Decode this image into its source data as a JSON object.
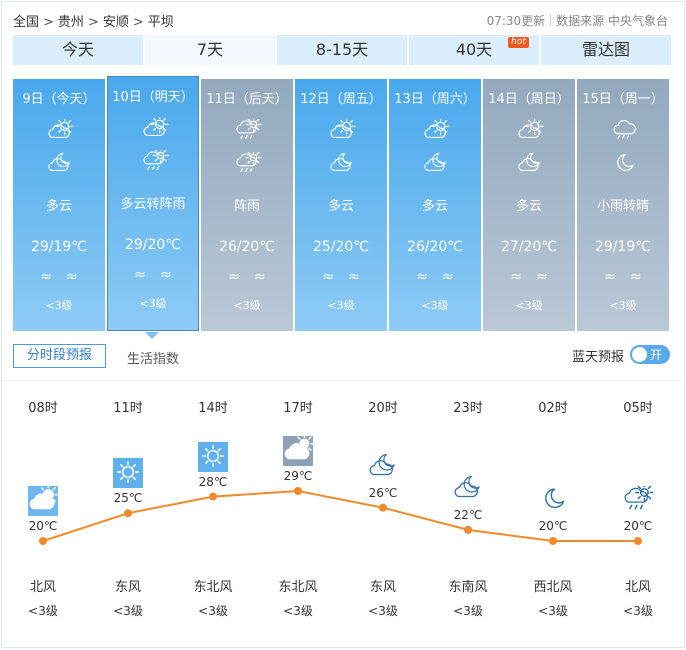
{
  "breadcrumb": [
    "全国",
    "贵州",
    "安顺",
    "平坝"
  ],
  "breadcrumb_sep": ">",
  "meta": {
    "updated": "07:30更新",
    "source": "数据来源 中央气象台"
  },
  "tabs": [
    {
      "label": "今天",
      "active": false
    },
    {
      "label": "7天",
      "active": true
    },
    {
      "label": "8-15天",
      "active": false
    },
    {
      "label": "40天",
      "active": false,
      "badge": "hot"
    },
    {
      "label": "雷达图",
      "active": false
    }
  ],
  "days": [
    {
      "label": "9日（今天）",
      "icon_day": "partly-cloudy-day-icon",
      "icon_night": "cloudy-night-icon",
      "weather": "多云",
      "temp": "29/19℃",
      "wind": "≈≈",
      "level": "<3级",
      "style": "sunny"
    },
    {
      "label": "10日（明天）",
      "icon_day": "partly-cloudy-day-icon",
      "icon_night": "shower-rain-icon",
      "weather": "多云转阵雨",
      "temp": "29/20℃",
      "wind": "≈≈",
      "level": "<3级",
      "style": "sunny",
      "selected": true
    },
    {
      "label": "11日（后天）",
      "icon_day": "shower-day-icon",
      "icon_night": "shower-rain-icon",
      "weather": "阵雨",
      "temp": "26/20℃",
      "wind": "≈≈",
      "level": "<3级",
      "style": "grey"
    },
    {
      "label": "12日（周五）",
      "icon_day": "partly-cloudy-day-icon",
      "icon_night": "cloudy-night-icon",
      "weather": "多云",
      "temp": "25/20℃",
      "wind": "≈≈",
      "level": "<3级",
      "style": "sunny"
    },
    {
      "label": "13日（周六）",
      "icon_day": "partly-cloudy-day-icon",
      "icon_night": "cloudy-night-icon",
      "weather": "多云",
      "temp": "26/20℃",
      "wind": "≈≈",
      "level": "<3级",
      "style": "sunny"
    },
    {
      "label": "14日（周日）",
      "icon_day": "partly-cloudy-day-icon",
      "icon_night": "cloudy-night-icon",
      "weather": "多云",
      "temp": "27/20℃",
      "wind": "≈≈",
      "level": "<3级",
      "style": "grey"
    },
    {
      "label": "15日（周一）",
      "icon_day": "light-rain-icon",
      "icon_night": "moon-icon",
      "weather": "小雨转晴",
      "temp": "29/19℃",
      "wind": "≈≈",
      "level": "<3级",
      "style": "grey"
    }
  ],
  "subtabs": {
    "active": "分时段预报",
    "other": "生活指数"
  },
  "bluesky": {
    "label": "蓝天预报",
    "toggle": "开"
  },
  "chart_data": {
    "type": "line",
    "x": [
      "08时",
      "11时",
      "14时",
      "17时",
      "20时",
      "23时",
      "02时",
      "05时"
    ],
    "series": [
      {
        "values": [
          20,
          25,
          28,
          29,
          26,
          22,
          20,
          20
        ]
      }
    ],
    "temp_labels": [
      "20℃",
      "25℃",
      "28℃",
      "29℃",
      "26℃",
      "22℃",
      "20℃",
      "20℃"
    ],
    "icons": [
      "cloudy-sun-icon",
      "sun-icon",
      "sun-icon",
      "overcast-icon",
      "cloudy-night-icon",
      "cloudy-night-icon",
      "moon-icon",
      "shower-icon"
    ],
    "wind_dir": [
      "北风",
      "东风",
      "东北风",
      "东北风",
      "东风",
      "东南风",
      "西北风",
      "北风"
    ],
    "wind_level": [
      "<3级",
      "<3级",
      "<3级",
      "<3级",
      "<3级",
      "<3级",
      "<3级",
      "<3级"
    ],
    "line_color": "#f08a2a",
    "ylim": [
      20,
      29
    ]
  }
}
